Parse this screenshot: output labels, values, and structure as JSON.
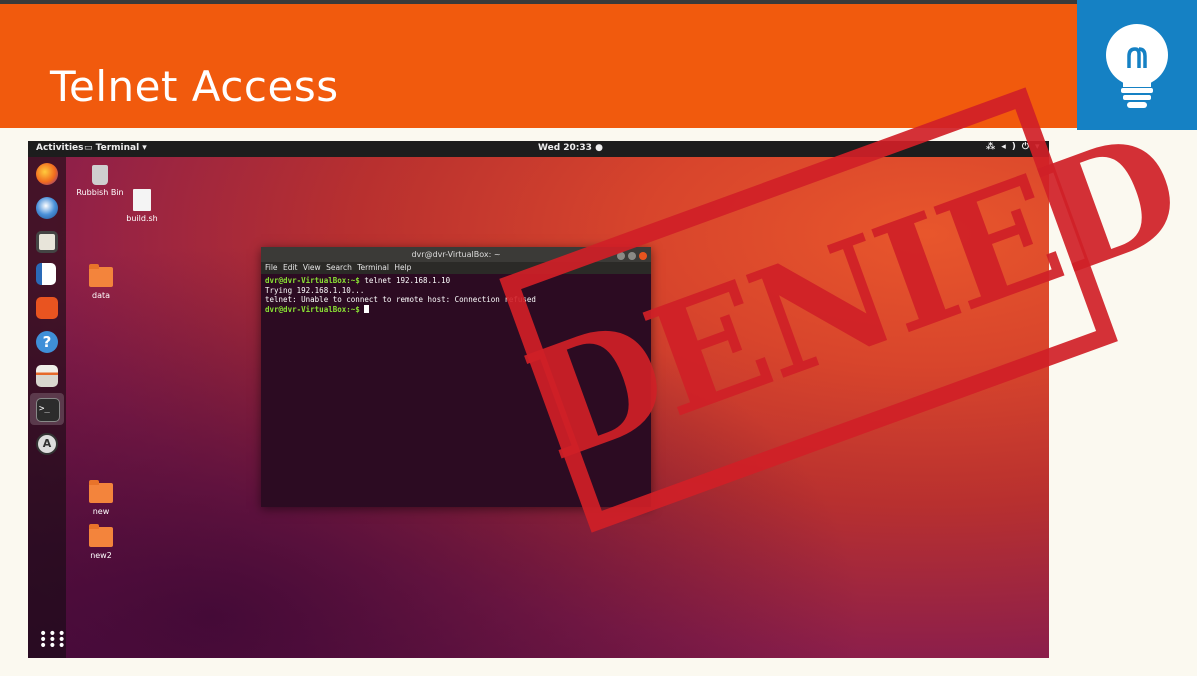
{
  "slide": {
    "title": "Telnet Access",
    "header_color": "#f15a0d",
    "icon": "lightbulb-icon",
    "icon_bg": "#1581c4"
  },
  "topbar": {
    "activities": "Activities",
    "app_menu": "Terminal ▾",
    "clock": "Wed 20:33 ●",
    "tray_icons": [
      "network-icon",
      "volume-icon",
      "power-icon",
      "chevron-down-icon"
    ]
  },
  "dock": {
    "items": [
      "firefox-icon",
      "thunderbird-icon",
      "rhythmbox-icon",
      "writer-icon",
      "software-icon",
      "help-icon",
      "files-icon",
      "terminal-icon",
      "updater-icon"
    ],
    "show_apps": "apps-grid-icon"
  },
  "desktop": {
    "rubbish_bin": "Rubbish Bin",
    "build_file": "build.sh",
    "folder_data": "data",
    "folder_new": "new",
    "folder_new2": "new2"
  },
  "terminal": {
    "title": "dvr@dvr-VirtualBox: ~",
    "menu": [
      "File",
      "Edit",
      "View",
      "Search",
      "Terminal",
      "Help"
    ],
    "prompt": "dvr@dvr-VirtualBox:~$",
    "command": " telnet 192.168.1.10",
    "line2": "Trying 192.168.1.10...",
    "line3": "telnet: Unable to connect to remote host: Connection refused"
  },
  "stamp": {
    "text": "DENIED",
    "color": "#d02027"
  }
}
